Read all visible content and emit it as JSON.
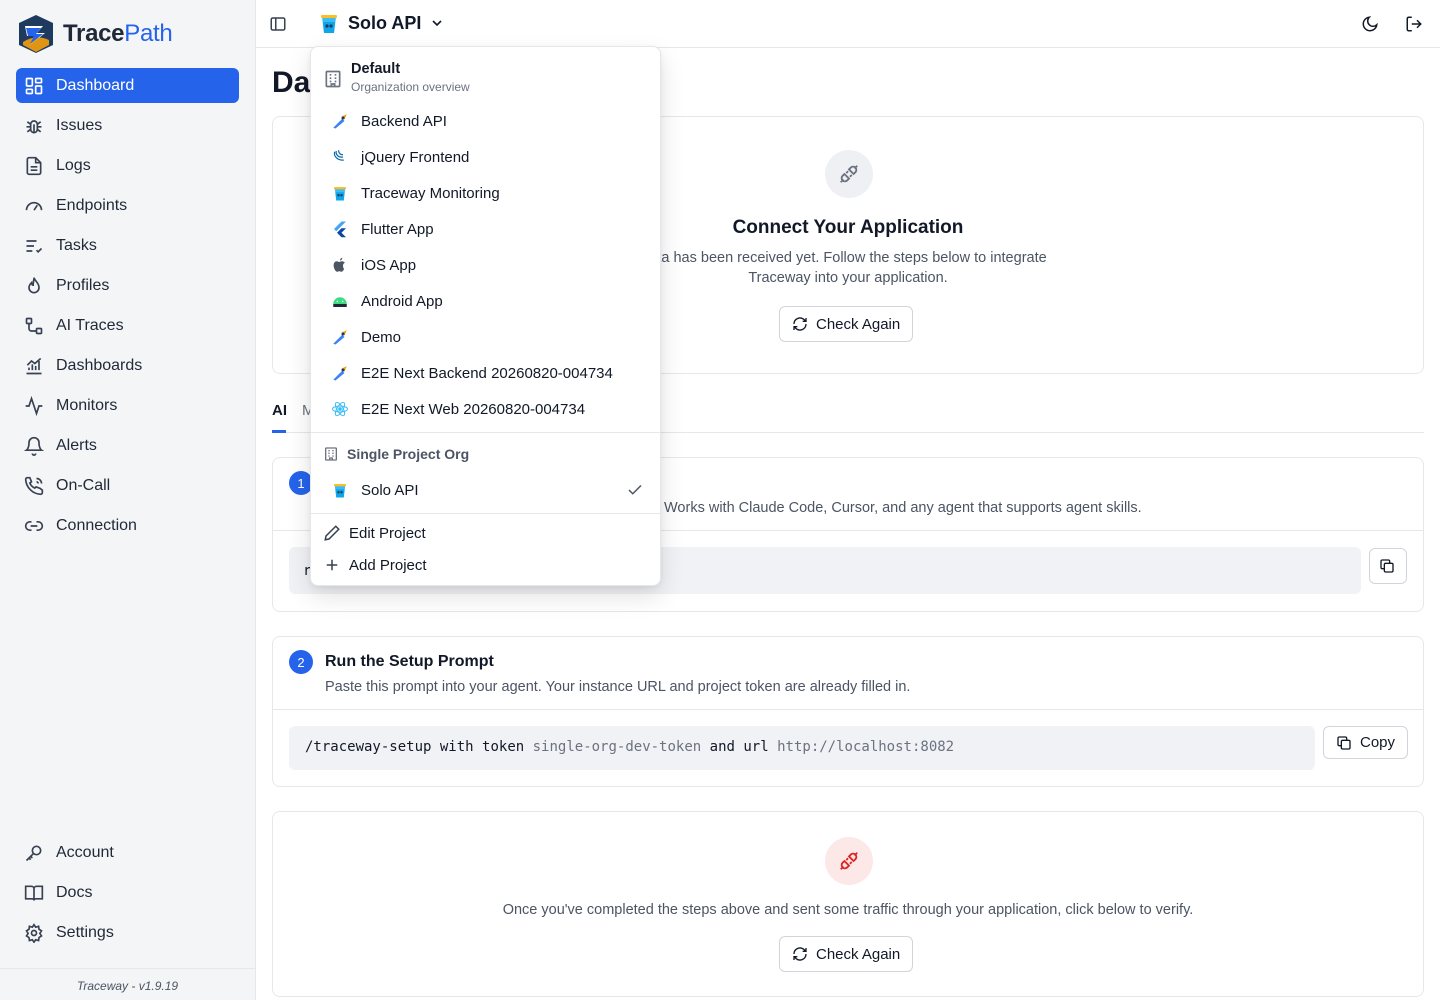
{
  "brand": {
    "name_part1": "Trace",
    "name_part2": "Path"
  },
  "sidebar": {
    "items": [
      {
        "label": "Dashboard",
        "icon": "dashboard-icon",
        "active": true
      },
      {
        "label": "Issues",
        "icon": "bug-icon"
      },
      {
        "label": "Logs",
        "icon": "file-text-icon"
      },
      {
        "label": "Endpoints",
        "icon": "gauge-icon"
      },
      {
        "label": "Tasks",
        "icon": "list-check-icon"
      },
      {
        "label": "Profiles",
        "icon": "flame-icon"
      },
      {
        "label": "AI Traces",
        "icon": "nodes-icon"
      },
      {
        "label": "Dashboards",
        "icon": "chart-icon"
      },
      {
        "label": "Monitors",
        "icon": "activity-icon"
      },
      {
        "label": "Alerts",
        "icon": "bell-icon"
      },
      {
        "label": "On-Call",
        "icon": "phone-icon"
      },
      {
        "label": "Connection",
        "icon": "link-icon"
      }
    ],
    "bottom_items": [
      {
        "label": "Account",
        "icon": "key-icon"
      },
      {
        "label": "Docs",
        "icon": "book-icon"
      },
      {
        "label": "Settings",
        "icon": "gear-icon"
      }
    ],
    "version": "Traceway - v1.9.19"
  },
  "topbar": {
    "project_name": "Solo API"
  },
  "main": {
    "page_title_fragment": "Da",
    "connect_card": {
      "title": "Connect Your Application",
      "desc_line1": "ata has been received yet. Follow the steps below to integrate",
      "desc_line2": "Traceway into your application.",
      "button": "Check Again"
    },
    "tabs": [
      "AI",
      "M"
    ],
    "step1": {
      "number": "1",
      "desc": "Works with Claude Code, Cursor, and any agent that supports agent skills.",
      "code_fragment": "r"
    },
    "step2": {
      "number": "2",
      "title": "Run the Setup Prompt",
      "desc": "Paste this prompt into your agent. Your instance URL and project token are already filled in.",
      "cmd": "/traceway-setup",
      "w1": "with",
      "w2": "token",
      "token": "single-org-dev-token",
      "w3": "and",
      "w4": "url",
      "url": "http://localhost:8082",
      "copy": "Copy"
    },
    "verify_card": {
      "desc": "Once you've completed the steps above and sent some traffic through your application, click below to verify.",
      "button": "Check Again"
    }
  },
  "dropdown": {
    "org1": {
      "name": "Default",
      "sub": "Organization overview"
    },
    "projects": [
      {
        "label": "Backend API",
        "icon": "go-gopher-icon"
      },
      {
        "label": "jQuery Frontend",
        "icon": "jquery-icon"
      },
      {
        "label": "Traceway Monitoring",
        "icon": "traceway-bucket-icon"
      },
      {
        "label": "Flutter App",
        "icon": "flutter-icon"
      },
      {
        "label": "iOS App",
        "icon": "apple-icon"
      },
      {
        "label": "Android App",
        "icon": "android-icon"
      },
      {
        "label": "Demo",
        "icon": "go-gopher-icon"
      },
      {
        "label": "E2E Next Backend 20260820-004734",
        "icon": "go-gopher-icon"
      },
      {
        "label": "E2E Next Web 20260820-004734",
        "icon": "react-icon"
      }
    ],
    "org2": {
      "name": "Single Project Org"
    },
    "org2_projects": [
      {
        "label": "Solo API",
        "icon": "traceway-bucket-icon",
        "selected": true
      }
    ],
    "actions": [
      {
        "label": "Edit Project",
        "icon": "pencil-icon"
      },
      {
        "label": "Add Project",
        "icon": "plus-icon"
      }
    ]
  },
  "colors": {
    "primary": "#2563eb",
    "danger_bg": "#fde8e8",
    "danger": "#dc2626"
  }
}
